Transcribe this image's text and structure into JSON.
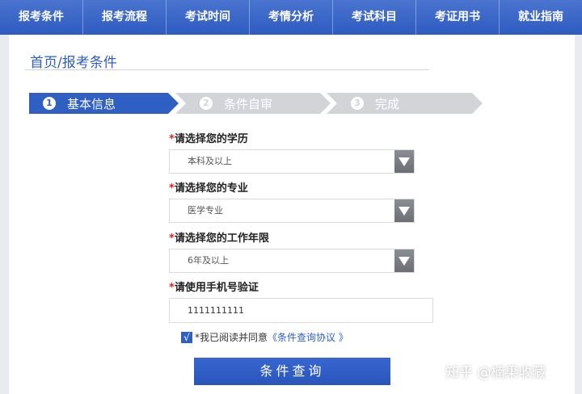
{
  "nav": [
    "报考条件",
    "报考流程",
    "考试时间",
    "考情分析",
    "考试科目",
    "考证用书",
    "就业指南"
  ],
  "breadcrumb": "首页/报考条件",
  "steps": [
    {
      "num": "1",
      "label": "基本信息",
      "active": true
    },
    {
      "num": "2",
      "label": "条件自审",
      "active": false
    },
    {
      "num": "3",
      "label": "完成",
      "active": false
    }
  ],
  "form": {
    "education_label": "请选择您的学历",
    "education_value": "本科及以上",
    "major_label": "请选择您的专业",
    "major_value": "医学专业",
    "years_label": "请选择您的工作年限",
    "years_value": "6年及以上",
    "phone_label": "请使用手机号验证",
    "phone_value": "1111111111",
    "required_mark": "*",
    "agree_prefix": "*我已阅读并同意",
    "agree_link": "《条件查询协议 》",
    "checkbox_mark": "√",
    "submit": "条件查询"
  },
  "watermark": "知乎 @楠果收藏",
  "colors": {
    "accent": "#2f5fc2",
    "inactive_step": "#d2d4d8",
    "required": "#dd2222"
  }
}
